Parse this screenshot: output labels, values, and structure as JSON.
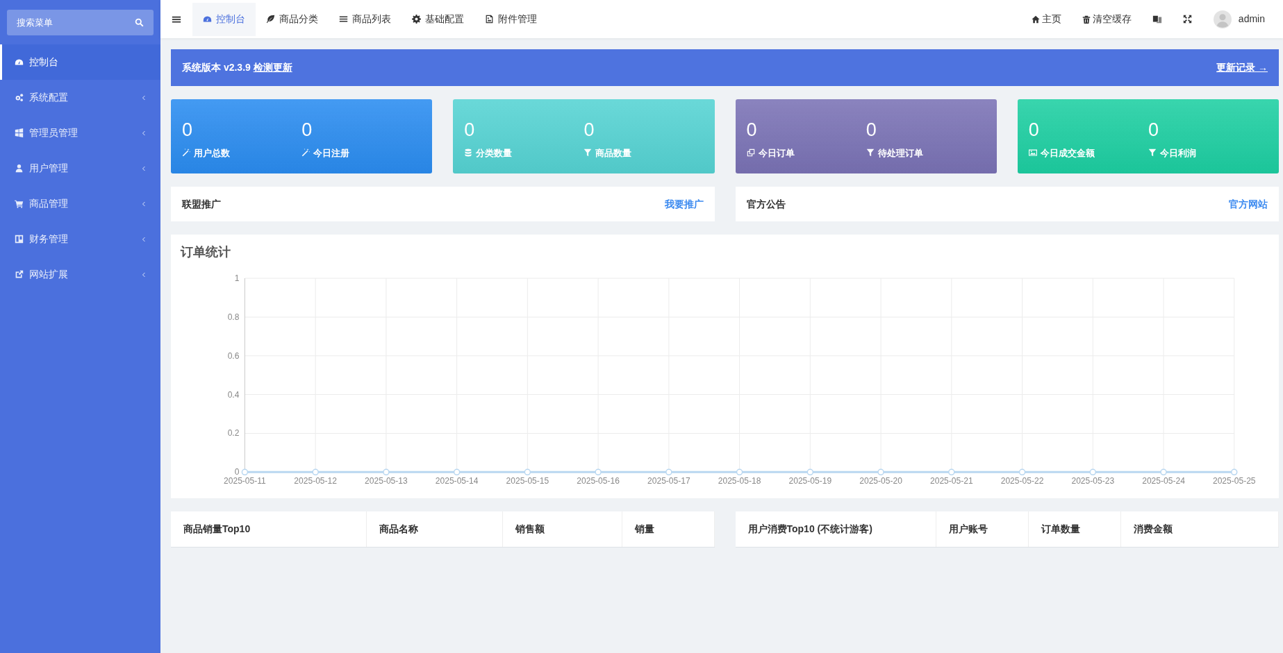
{
  "sidebar": {
    "search": {
      "placeholder": "搜索菜单"
    },
    "items": [
      {
        "label": "控制台",
        "selected": true,
        "has_submenu": false
      },
      {
        "label": "系统配置",
        "selected": false,
        "has_submenu": true
      },
      {
        "label": "管理员管理",
        "selected": false,
        "has_submenu": true
      },
      {
        "label": "用户管理",
        "selected": false,
        "has_submenu": true
      },
      {
        "label": "商品管理",
        "selected": false,
        "has_submenu": true
      },
      {
        "label": "财务管理",
        "selected": false,
        "has_submenu": true
      },
      {
        "label": "网站扩展",
        "selected": false,
        "has_submenu": true
      }
    ]
  },
  "tabs": [
    {
      "label": "控制台",
      "selected": true
    },
    {
      "label": "商品分类",
      "selected": false
    },
    {
      "label": "商品列表",
      "selected": false
    },
    {
      "label": "基础配置",
      "selected": false
    },
    {
      "label": "附件管理",
      "selected": false
    }
  ],
  "header_links": [
    "主页",
    "清空缓存"
  ],
  "user": {
    "name": "admin"
  },
  "banner": {
    "text": "系统版本 v2.3.9",
    "link": "检测更新",
    "right_link": "更新记录 →"
  },
  "stat_cards": [
    {
      "color": "#2a8cf0",
      "stats": [
        {
          "value": "0",
          "label": "用户总数"
        },
        {
          "value": "0",
          "label": "今日注册"
        }
      ]
    },
    {
      "color": "#55d3d3",
      "stats": [
        {
          "value": "0",
          "label": "分类数量"
        },
        {
          "value": "0",
          "label": "商品数量"
        }
      ]
    },
    {
      "color": "#7a72b5",
      "stats": [
        {
          "value": "0",
          "label": "今日订单"
        },
        {
          "value": "0",
          "label": "待处理订单"
        }
      ]
    },
    {
      "color": "#1dcfa2",
      "stats": [
        {
          "value": "0",
          "label": "今日成交金额"
        },
        {
          "value": "0",
          "label": "今日利润"
        }
      ]
    }
  ],
  "link_panels": [
    {
      "title": "联盟推广",
      "link": "我要推广"
    },
    {
      "title": "官方公告",
      "link": "官方网站"
    }
  ],
  "order_stats": {
    "title": "订单统计",
    "chart_data": {
      "type": "line",
      "categories": [
        "2025-05-11",
        "2025-05-12",
        "2025-05-13",
        "2025-05-14",
        "2025-05-15",
        "2025-05-16",
        "2025-05-17",
        "2025-05-18",
        "2025-05-19",
        "2025-05-20",
        "2025-05-21",
        "2025-05-22",
        "2025-05-23",
        "2025-05-24",
        "2025-05-25"
      ],
      "grid": true,
      "series": [
        {
          "color": "#b9d7f0",
          "marker": true,
          "values": [
            0,
            0,
            0,
            0,
            0,
            0,
            0,
            0,
            0,
            0,
            0,
            0,
            0,
            0,
            0
          ]
        }
      ],
      "ylim": [
        0,
        1
      ],
      "yticks": [
        0,
        0.2,
        0.4,
        0.6,
        0.8,
        1
      ]
    }
  },
  "tables": [
    {
      "columns": [
        "商品销量Top10",
        "商品名称",
        "销售额",
        "销量"
      ]
    },
    {
      "columns": [
        "用户消费Top10 (不统计游客)",
        "用户账号",
        "订单数量",
        "消费金额"
      ]
    }
  ]
}
